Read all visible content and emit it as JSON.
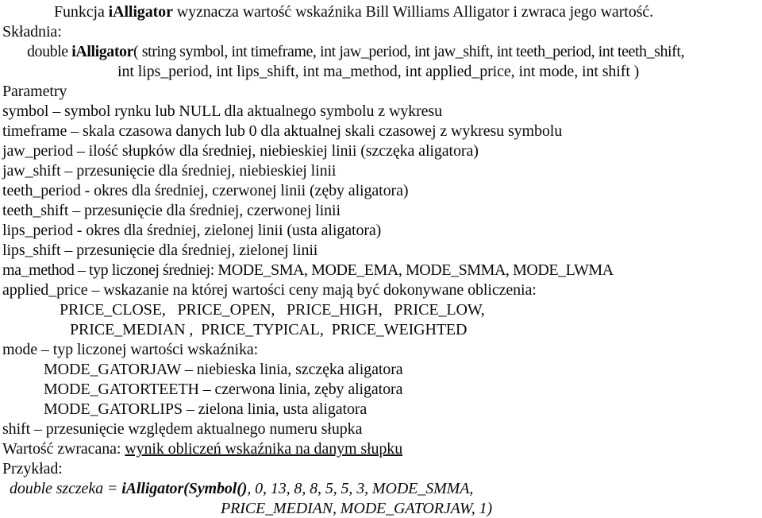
{
  "document": {
    "language": "pl",
    "title": "iAlligator",
    "text_color": "#0b0b0b",
    "background_color": "#ffffff"
  },
  "intro": {
    "before_name": "Funkcja ",
    "function_name": "iAlligator",
    "after_name": " wyznacza wartość wskaźnika Bill Williams Alligator i zwraca jego wartość."
  },
  "syntax": {
    "heading": "Składnia:",
    "return_type": "double ",
    "function_name": "iAlligator",
    "signature_line1": "( string symbol, int timeframe, int jaw_period, int jaw_shift, int teeth_period, int teeth_shift,",
    "signature_line2": "int lips_period, int lips_shift, int ma_method, int applied_price, int mode, int shift )"
  },
  "parameters": {
    "heading": "Parametry",
    "items": [
      "symbol – symbol rynku lub NULL dla aktualnego symbolu z wykresu",
      "timeframe – skala czasowa danych lub 0 dla aktualnej skali czasowej z wykresu symbolu",
      "jaw_period – ilość słupków dla średniej, niebieskiej linii (szczęka aligatora)",
      "jaw_shift – przesunięcie dla średniej, niebieskiej linii",
      "teeth_period - okres dla średniej, czerwonej linii (zęby aligatora)",
      "teeth_shift – przesunięcie dla średniej, czerwonej linii",
      "lips_period - okres dla średniej, zielonej linii (usta aligatora)",
      "lips_shift – przesunięcie dla średniej, zielonej linii",
      "ma_method – typ liczonej średniej: MODE_SMA, MODE_EMA, MODE_SMMA, MODE_LWMA",
      "applied_price – wskazanie na której wartości ceny mają być dokonywane obliczenia:"
    ],
    "applied_price_values_line1": "PRICE_CLOSE,   PRICE_OPEN,   PRICE_HIGH,   PRICE_LOW,",
    "applied_price_values_line2": "PRICE_MEDIAN ,  PRICE_TYPICAL,  PRICE_WEIGHTED",
    "mode_label": "mode – typ liczonej wartości wskaźnika:",
    "mode_values": [
      "MODE_GATORJAW – niebieska linia, szczęka aligatora",
      "MODE_GATORTEETH – czerwona linia, zęby aligatora",
      "MODE_GATORLIPS – zielona linia, usta aligatora"
    ],
    "shift_item": "shift – przesunięcie względem aktualnego numeru słupka"
  },
  "return_value": {
    "label": "Wartość zwracana: ",
    "value": "wynik obliczeń wskaźnika na danym słupku"
  },
  "example": {
    "heading": "Przykład:",
    "decl": "double szczeka = ",
    "call_bold": "iAlligator(Symbol()",
    "call_rest": ", 0, 13, 8, 8, 5, 5, 3, MODE_SMMA,",
    "call_line2": "PRICE_MEDIAN, MODE_GATORJAW, 1)"
  }
}
